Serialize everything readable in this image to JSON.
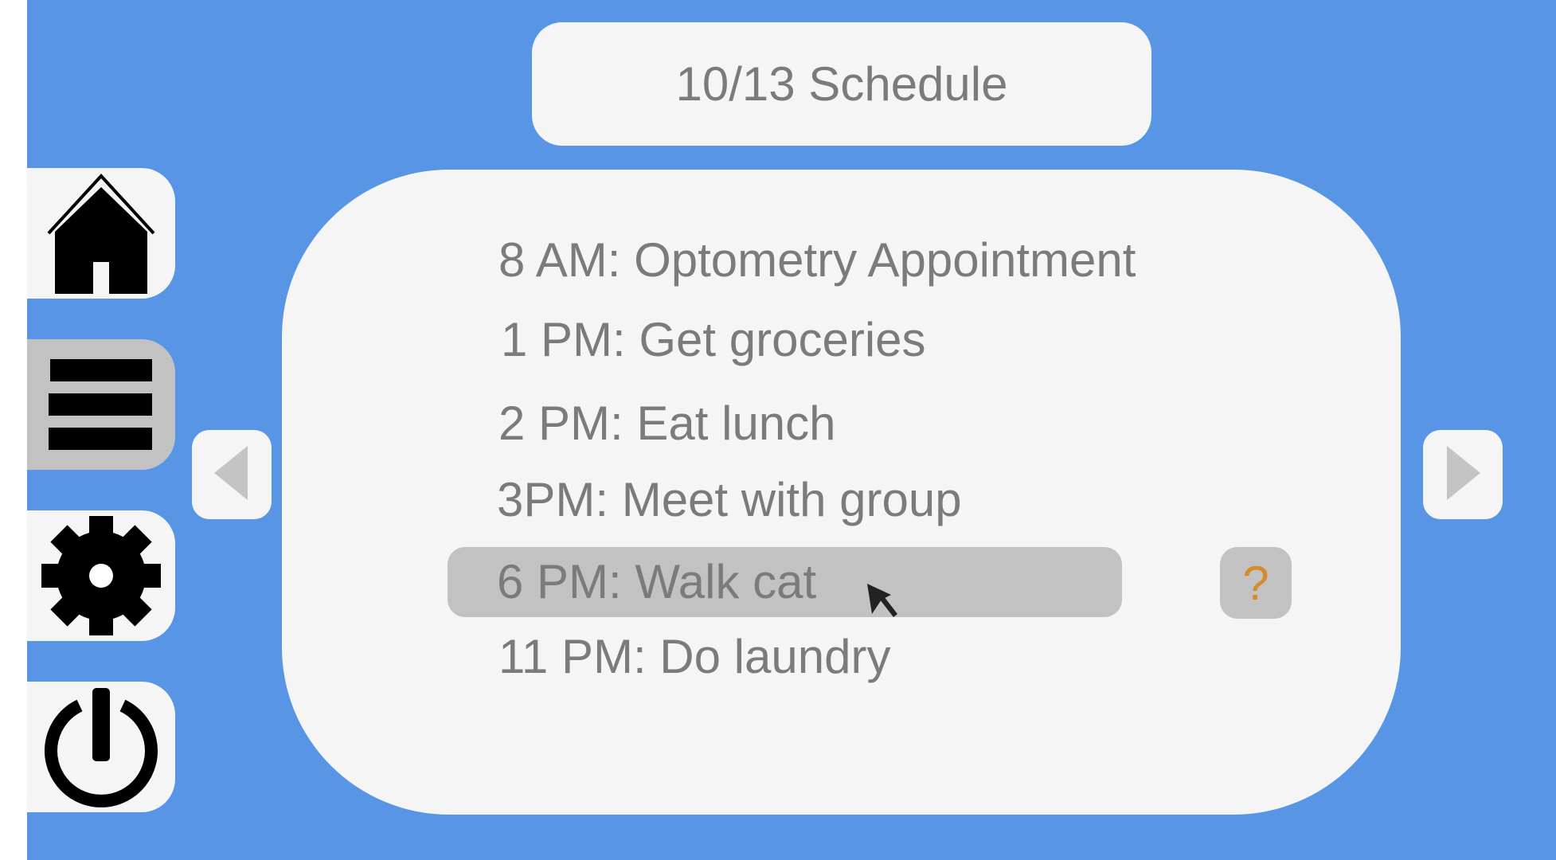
{
  "header": {
    "title": "10/13 Schedule"
  },
  "sidebar": {
    "items": [
      {
        "id": "home",
        "icon": "home-icon",
        "active": false
      },
      {
        "id": "schedule",
        "icon": "menu-icon",
        "active": true
      },
      {
        "id": "settings",
        "icon": "gear-icon",
        "active": false
      },
      {
        "id": "power",
        "icon": "power-icon",
        "active": false
      }
    ]
  },
  "schedule": {
    "items": [
      "8 AM: Optometry Appointment",
      "1 PM: Get groceries",
      "2 PM: Eat lunch",
      "3PM: Meet with group",
      "6 PM: Walk cat",
      "11 PM: Do laundry"
    ],
    "selected_index": 4
  },
  "help_button": {
    "label": "?"
  },
  "navigation": {
    "prev_icon": "chevron-left-icon",
    "next_icon": "chevron-right-icon"
  },
  "colors": {
    "background": "#5896e5",
    "panel": "#f5f5f5",
    "selected": "#c2c2c2",
    "text": "#7b7b7b",
    "help_accent": "#d98a2b"
  }
}
